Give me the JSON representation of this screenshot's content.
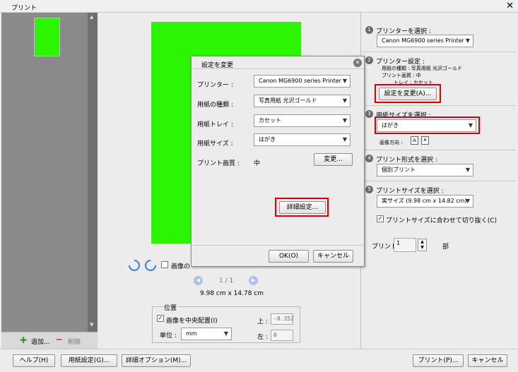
{
  "window": {
    "title": "プリント",
    "close_glyph": "✕"
  },
  "thumbnails": {
    "add_label": "追加...",
    "remove_label": "削除",
    "scroll_up": "▲",
    "scroll_down": "▼"
  },
  "preview": {
    "overlay_checkbox_label": "画像の",
    "page_indicator": "1 / 1",
    "print_size_text": "9.98 cm x 14.78 cm",
    "position": {
      "group_label": "位置",
      "center_label": "画像を中央配置(I)",
      "center_checked": "✓",
      "unit_label": "単位 :",
      "unit_value": "mm",
      "top_label": "上 :",
      "top_value": "-0.352",
      "left_label": "左 :",
      "left_value": "0"
    }
  },
  "right_panel": {
    "step1": {
      "num": "1",
      "title": "プリンターを選択 :",
      "printer": "Canon MG6900 series Printer"
    },
    "step2": {
      "num": "2",
      "title": "プリンター設定 :",
      "paper_type_line": "用紙の種類 : 写真用紙 光沢ゴールド",
      "quality_line": "プリント画質 : 中",
      "tray_line": "トレイ : カセット",
      "change_settings_button": "設定を変更(A)..."
    },
    "step3": {
      "num": "3",
      "title": "用紙サイズを選択 :",
      "paper_size": "はがき",
      "orientation_label": "画像方向 :",
      "portrait_glyph": "A",
      "landscape_glyph": "A"
    },
    "step4": {
      "num": "4",
      "title": "プリント形式を選択 :",
      "format": "個別プリント"
    },
    "step5": {
      "num": "5",
      "title": "プリントサイズを選択 :",
      "size": "実サイズ (9.98 cm x 14.82 cm)",
      "crop_label": "プリントサイズに合わせて切り抜く(C)",
      "crop_checked": "✓"
    },
    "copies": {
      "label": "プリント",
      "value": "1",
      "unit": "部",
      "up": "▲",
      "down": "▼"
    }
  },
  "dialog": {
    "title": "設定を変更",
    "close_glyph": "✕",
    "printer_label": "プリンター :",
    "printer_value": "Canon MG6900 series Printer",
    "paper_type_label": "用紙の種類 :",
    "paper_type_value": "写真用紙 光沢ゴールド",
    "tray_label": "用紙トレイ :",
    "tray_value": "カセット",
    "size_label": "用紙サイズ :",
    "size_value": "はがき",
    "quality_label": "プリント画質 :",
    "quality_value": "中",
    "change_button": "変更...",
    "advanced_button": "詳細設定...",
    "ok_button": "OK(O)",
    "cancel_button": "キャンセル"
  },
  "bottom_bar": {
    "help_button": "ヘルプ(H)",
    "page_setup_button": "用紙設定(G)...",
    "more_options_button": "詳細オプション(M)...",
    "print_button": "プリント(P)...",
    "cancel_button": "キャンセル"
  },
  "colors": {
    "paper_preview": "#2cf500",
    "highlight": "#e00000",
    "thumb_panel": "#8a8a8a"
  }
}
